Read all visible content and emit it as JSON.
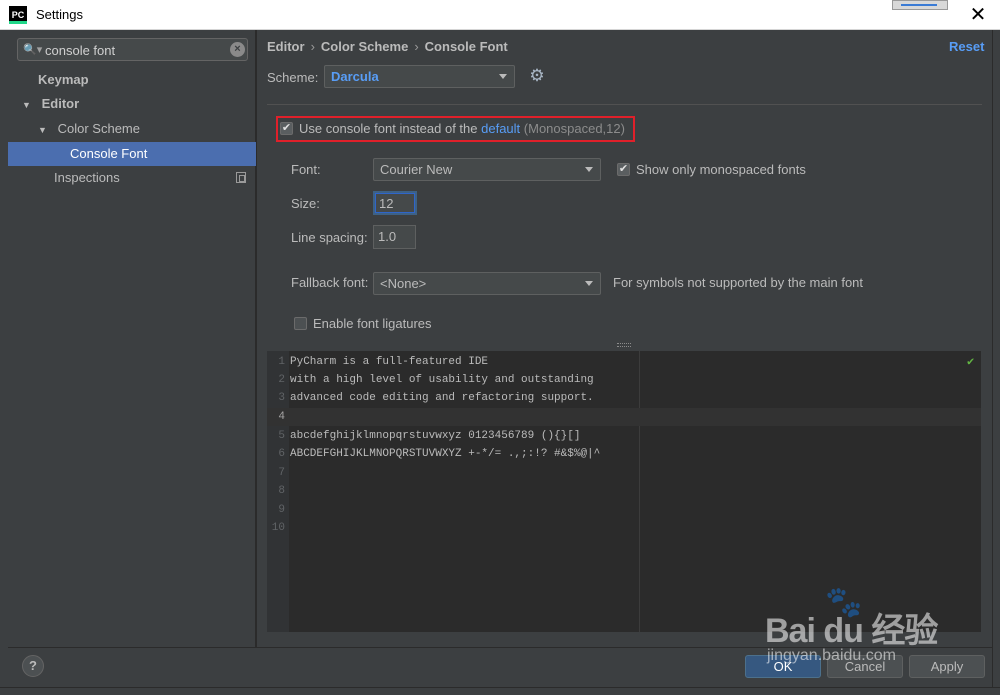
{
  "window": {
    "title": "Settings",
    "app_icon": "PC",
    "close_icon": "close-icon"
  },
  "sidebar": {
    "search": {
      "value": "console font",
      "placeholder": ""
    },
    "items": [
      {
        "label": "Keymap",
        "level": 0,
        "bold": true
      },
      {
        "label": "Editor",
        "level": 0,
        "bold": true,
        "expanded": true
      },
      {
        "label": "Color Scheme",
        "level": 1,
        "expanded": true
      },
      {
        "label": "Console Font",
        "level": 2,
        "selected": true
      },
      {
        "label": "Inspections",
        "level": 1
      }
    ]
  },
  "header": {
    "breadcrumb": [
      "Editor",
      "Color Scheme",
      "Console Font"
    ],
    "reset_label": "Reset"
  },
  "scheme": {
    "label": "Scheme:",
    "value": "Darcula"
  },
  "use_console_font": {
    "checked": true,
    "text_before": "Use console font instead of the ",
    "link": "default",
    "hint": " (Monospaced,12)"
  },
  "font": {
    "label": "Font:",
    "value": "Courier New",
    "mono_only_label": "Show only monospaced fonts",
    "mono_only_checked": true
  },
  "size": {
    "label": "Size:",
    "value": "12"
  },
  "line_spacing": {
    "label": "Line spacing:",
    "value": "1.0"
  },
  "fallback": {
    "label": "Fallback font:",
    "value": "<None>",
    "hint": "For symbols not supported by the main font"
  },
  "ligatures": {
    "label": "Enable font ligatures",
    "checked": false
  },
  "preview": {
    "lines": [
      {
        "num": "1",
        "text": "PyCharm is a full-featured IDE"
      },
      {
        "num": "2",
        "text": "with a high level of usability and outstanding"
      },
      {
        "num": "3",
        "text": "advanced code editing and refactoring support."
      },
      {
        "num": "4",
        "text": ""
      },
      {
        "num": "5",
        "text": "abcdefghijklmnopqrstuvwxyz 0123456789 (){}[]"
      },
      {
        "num": "6",
        "text": "ABCDEFGHIJKLMNOPQRSTUVWXYZ +-*/= .,;:!? #&$%@|^"
      },
      {
        "num": "7",
        "text": ""
      },
      {
        "num": "8",
        "text": ""
      },
      {
        "num": "9",
        "text": ""
      },
      {
        "num": "10",
        "text": ""
      }
    ]
  },
  "footer": {
    "help": "?",
    "ok_label": "OK",
    "cancel_label": "Cancel",
    "apply_label": "Apply"
  },
  "watermark": {
    "brand": "Bai  du 经验",
    "url": "jingyan.baidu.com"
  },
  "colors": {
    "accent": "#4b6eaf",
    "link": "#589df6",
    "highlight_border": "#e0202a",
    "background": "#3c3f41",
    "editor_bg": "#2b2b2b"
  }
}
